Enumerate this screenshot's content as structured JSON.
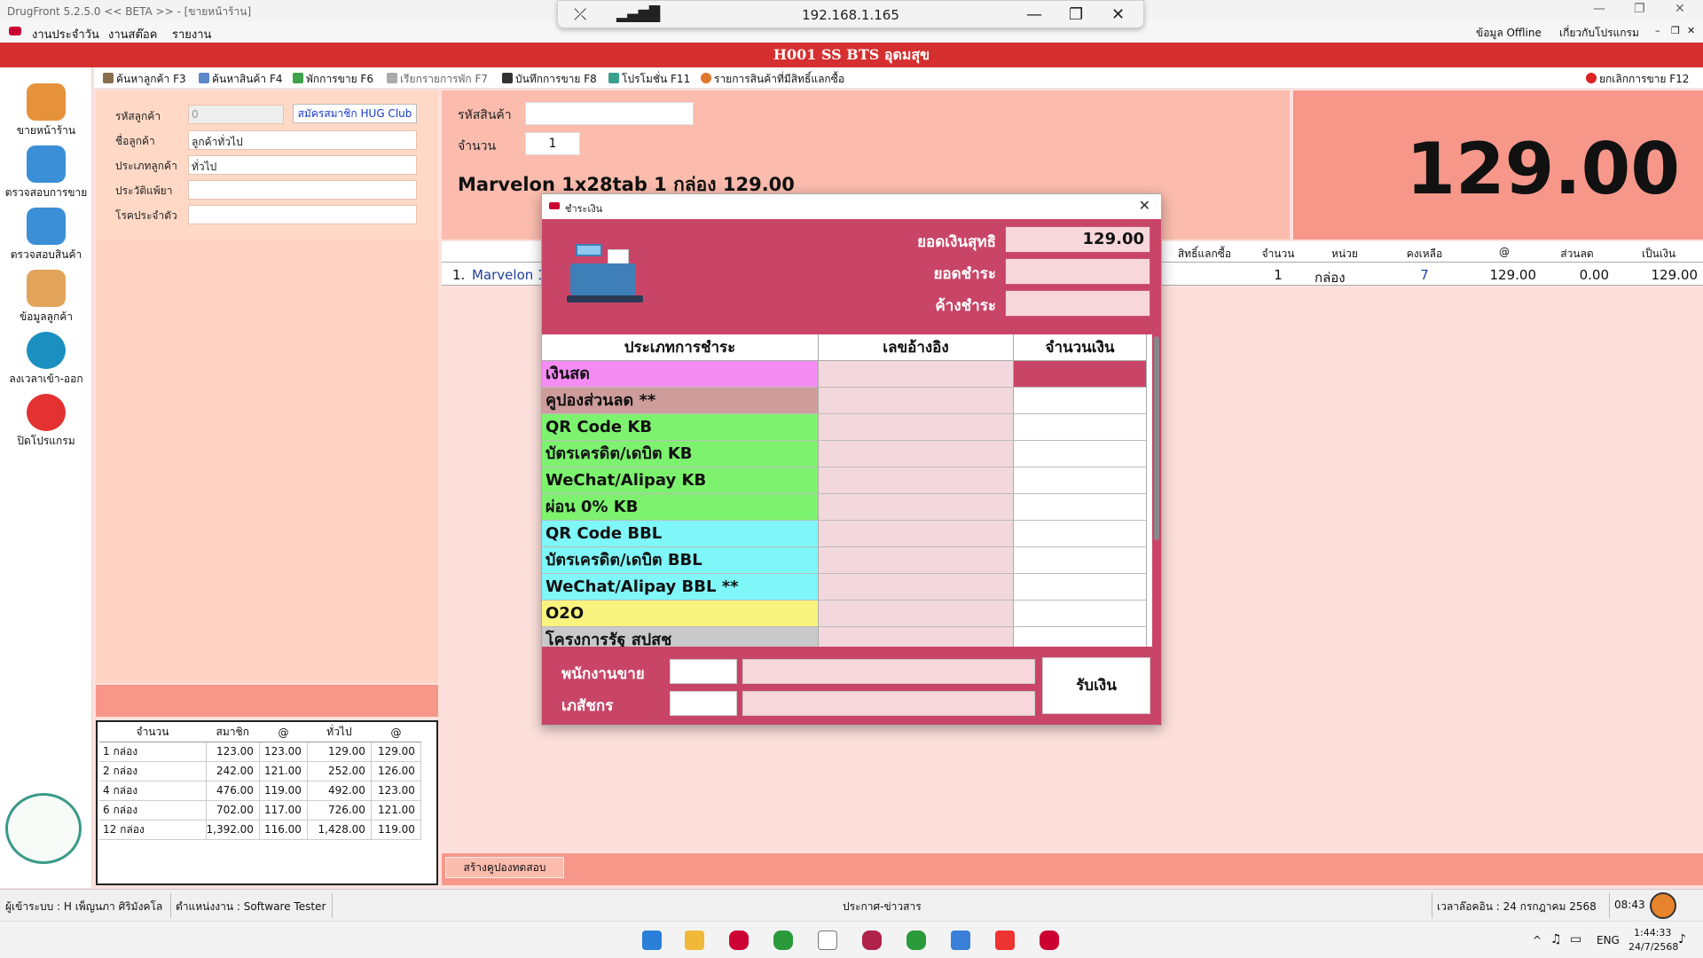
{
  "window": {
    "title": "DrugFront 5.2.5.0 << BETA >> - [ขายหน้าร้าน]",
    "banner": "H001 SS BTS อุดมสุข"
  },
  "remote": {
    "ip": "192.168.1.165"
  },
  "menu": {
    "items": [
      "งานประจำวัน",
      "งานสต๊อค",
      "รายงาน"
    ],
    "right": [
      "ข้อมูล Offline",
      "เกี่ยวกับโปรแกรม"
    ]
  },
  "nav": [
    {
      "label": "ขายหน้าร้าน",
      "icon": "cash-register-icon",
      "color": "#e6923a"
    },
    {
      "label": "ตรวจสอบการขาย",
      "icon": "magnifier-icon",
      "color": "#3b8fd6"
    },
    {
      "label": "ตรวจสอบสินค้า",
      "icon": "magnifier-icon",
      "color": "#3b8fd6"
    },
    {
      "label": "ข้อมูลลูกค้า",
      "icon": "users-icon",
      "color": "#e2a35b"
    },
    {
      "label": "ลงเวลาเข้า-ออก",
      "icon": "clock-icon",
      "color": "#1b8fbf"
    },
    {
      "label": "ปิดโปรแกรม",
      "icon": "power-icon",
      "color": "#e43131"
    }
  ],
  "toolbar": {
    "items": [
      "ค้นหาลูกค้า F3",
      "ค้นหาสินค้า F4",
      "พักการขาย F6",
      "เรียกรายการพัก F7",
      "บันทึกการขาย F8",
      "โปรโมชั่น F11",
      "รายการสินค้าที่มีสิทธิ์แลกซื้อ"
    ],
    "cancel": "ยกเลิกการขาย F12"
  },
  "customer": {
    "labels": {
      "code": "รหัสลูกค้า",
      "name": "ชื่อลูกค้า",
      "type": "ประเภทลูกค้า",
      "allergy": "ประวัติแพ้ยา",
      "disease": "โรคประจำตัว"
    },
    "values": {
      "code": "0",
      "name": "ลูกค้าทั่วไป",
      "type": "ทั่วไป",
      "allergy": "",
      "disease": ""
    },
    "hug_button": "สมัครสมาชิก HUG Club"
  },
  "price_table": {
    "headers": [
      "จำนวน",
      "สมาชิก",
      "@",
      "ทั่วไป",
      "@"
    ],
    "rows": [
      [
        "1 กล่อง",
        "123.00",
        "123.00",
        "129.00",
        "129.00"
      ],
      [
        "2 กล่อง",
        "242.00",
        "121.00",
        "252.00",
        "126.00"
      ],
      [
        "4 กล่อง",
        "476.00",
        "119.00",
        "492.00",
        "123.00"
      ],
      [
        "6 กล่อง",
        "702.00",
        "117.00",
        "726.00",
        "121.00"
      ],
      [
        "12 กล่อง",
        "1,392.00",
        "116.00",
        "1,428.00",
        "119.00"
      ]
    ]
  },
  "product": {
    "sku_label": "รหัสสินค้า",
    "qty_label": "จำนวน",
    "qty_value": "1",
    "title": "Marvelon 1x28tab  1  กล่อง 129.00",
    "total": "129.00"
  },
  "grid": {
    "headers": {
      "redeem": "สิทธิ์แลกซื้อ",
      "qty": "จำนวน",
      "unit": "หน่วย",
      "remain": "คงเหลือ",
      "price": "@",
      "discount": "ส่วนลด",
      "amount": "เป็นเงิน"
    },
    "row": {
      "no": "1.",
      "name": "Marvelon 1",
      "qty": "1",
      "unit": "กล่อง",
      "remain": "7",
      "price": "129.00",
      "discount": "0.00",
      "amount": "129.00"
    }
  },
  "coupon_button": "สร้างคูปองทดสอบ",
  "dialog": {
    "title": "ชำระเงิน",
    "net_label": "ยอดเงินสุทธิ",
    "net_value": "129.00",
    "paid_label": "ยอดชำระ",
    "paid_value": "",
    "due_label": "ค้างชำระ",
    "due_value": "",
    "headers": [
      "ประเภทการชำระ",
      "เลขอ้างอิง",
      "จำนวนเงิน"
    ],
    "methods": [
      {
        "name": "เงินสด",
        "color": "#f48cf4"
      },
      {
        "name": "คูปองส่วนลด **",
        "color": "#cf9c9c"
      },
      {
        "name": "QR Code KB",
        "color": "#7df26f"
      },
      {
        "name": "บัตรเครดิต/เดบิต KB",
        "color": "#7df26f"
      },
      {
        "name": "WeChat/Alipay KB",
        "color": "#7df26f"
      },
      {
        "name": "ผ่อน 0% KB",
        "color": "#7df26f"
      },
      {
        "name": "QR Code BBL",
        "color": "#7ff6f8"
      },
      {
        "name": "บัตรเครดิต/เดบิต BBL",
        "color": "#7ff6f8"
      },
      {
        "name": "WeChat/Alipay BBL **",
        "color": "#7ff6f8"
      },
      {
        "name": "O2O",
        "color": "#f8f47f"
      },
      {
        "name": "โครงการรัฐ สปสช",
        "color": "#c9c9c9"
      }
    ],
    "seller_label": "พนักงานขาย",
    "pharmacist_label": "เภสัชกร",
    "receive_button": "รับเงิน"
  },
  "status": {
    "user": "ผู้เข้าระบบ : H เพ็ญนภา ศิริมังคโล",
    "position": "ตำแหน่งงาน : Software Tester",
    "news": "ประกาศ-ข่าวสาร",
    "date": "เวลาล๊อคอิน : 24  กรกฎาคม  2568",
    "time": "08:43"
  },
  "taskbar": {
    "lang": "ENG",
    "clock": "1:44:33",
    "date": "24/7/2568"
  },
  "accent": {
    "banner": "#d62f2f",
    "dialog": "#c94567"
  }
}
